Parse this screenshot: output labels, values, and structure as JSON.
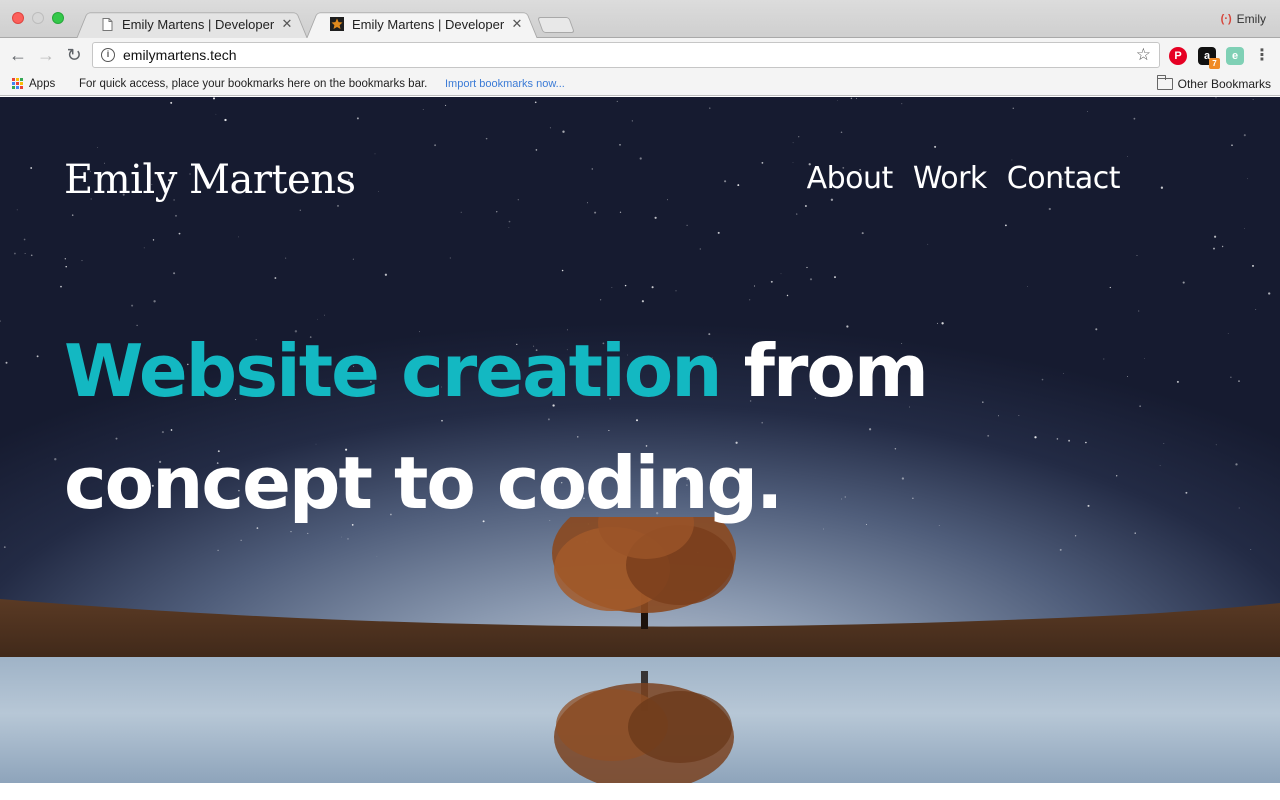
{
  "browser": {
    "tabs": [
      {
        "title": "Emily Martens | Developer",
        "favicon": "page-icon",
        "active": false
      },
      {
        "title": "Emily Martens | Developer",
        "favicon": "star-icon",
        "active": true
      }
    ],
    "profile_name": "Emily",
    "url": "emilymartens.tech",
    "bookmarks": {
      "apps_label": "Apps",
      "hint": "For quick access, place your bookmarks here on the bookmarks bar.",
      "import_link": "Import bookmarks now...",
      "other_bookmarks": "Other Bookmarks"
    },
    "extensions": [
      "pinterest-icon",
      "amazon-assistant-icon",
      "evernote-icon"
    ],
    "extension_badge": "7"
  },
  "site": {
    "logo": "Emily Martens",
    "nav": [
      {
        "label": "About"
      },
      {
        "label": "Work"
      },
      {
        "label": "Contact"
      }
    ],
    "hero": {
      "accent": "Website creation",
      "rest": " from concept to coding."
    },
    "colors": {
      "accent": "#13b8c2",
      "sky_dark": "#161b30",
      "horizon": "#c6d0dc"
    }
  }
}
